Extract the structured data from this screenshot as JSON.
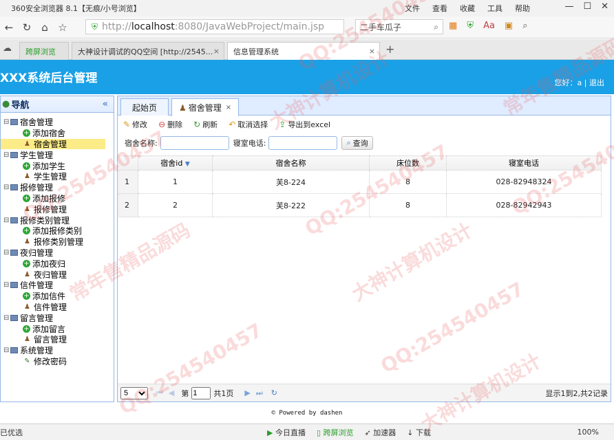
{
  "browser": {
    "window_title": "360安全浏览器 8.1【无痕/小号浏览】",
    "menus": [
      "文件",
      "查看",
      "收藏",
      "工具",
      "帮助"
    ],
    "address_prefix": "http://",
    "address_host": "localhost",
    "address_rest": ":8080/JavaWebProject/main.jsp",
    "search_text": "二手车瓜子",
    "tabs": [
      {
        "label": "跨屏浏览"
      },
      {
        "label": "大神设计调试的QQ空间 [http://2545..."
      },
      {
        "label": "信息管理系统"
      }
    ]
  },
  "app": {
    "title": "XXX系统后台管理",
    "user_text": "您好：a",
    "logout": "退出"
  },
  "sidenav": {
    "title": "导航",
    "groups": [
      {
        "label": "宿舍管理",
        "children": [
          {
            "label": "添加宿舍",
            "icon": "add"
          },
          {
            "label": "宿舍管理",
            "icon": "user",
            "selected": true
          }
        ]
      },
      {
        "label": "学生管理",
        "children": [
          {
            "label": "添加学生",
            "icon": "add"
          },
          {
            "label": "学生管理",
            "icon": "user"
          }
        ]
      },
      {
        "label": "报修管理",
        "children": [
          {
            "label": "添加报修",
            "icon": "add"
          },
          {
            "label": "报修管理",
            "icon": "user"
          }
        ]
      },
      {
        "label": "报修类别管理",
        "children": [
          {
            "label": "添加报修类别",
            "icon": "add"
          },
          {
            "label": "报修类别管理",
            "icon": "user"
          }
        ]
      },
      {
        "label": "夜归管理",
        "children": [
          {
            "label": "添加夜归",
            "icon": "add"
          },
          {
            "label": "夜归管理",
            "icon": "user"
          }
        ]
      },
      {
        "label": "信件管理",
        "children": [
          {
            "label": "添加信件",
            "icon": "add"
          },
          {
            "label": "信件管理",
            "icon": "user"
          }
        ]
      },
      {
        "label": "留言管理",
        "children": [
          {
            "label": "添加留言",
            "icon": "add"
          },
          {
            "label": "留言管理",
            "icon": "user"
          }
        ]
      },
      {
        "label": "系统管理",
        "children": [
          {
            "label": "修改密码",
            "icon": "pen"
          }
        ]
      }
    ]
  },
  "content": {
    "tabs": [
      {
        "label": "起始页"
      },
      {
        "label": "宿舍管理"
      }
    ],
    "toolbar": {
      "edit": "修改",
      "delete": "删除",
      "refresh": "刷新",
      "deselect": "取消选择",
      "export": "导出到excel"
    },
    "filters": {
      "name_label": "宿舍名称:",
      "name_value": "",
      "phone_label": "寝室电话:",
      "phone_value": "",
      "query_button": "查询"
    },
    "table": {
      "columns": [
        "宿舍id",
        "宿舍名称",
        "床位数",
        "寝室电话"
      ],
      "rows": [
        {
          "rownum": "1",
          "id": "1",
          "name": "芙8-224",
          "beds": "8",
          "phone": "028-82948324"
        },
        {
          "rownum": "2",
          "id": "2",
          "name": "芙8-222",
          "beds": "8",
          "phone": "028-82942943"
        }
      ]
    },
    "pager": {
      "page_size": "5",
      "page_prefix": "第",
      "page_value": "1",
      "page_suffix": "共1页",
      "info": "显示1到2,共2记录"
    }
  },
  "footer": "Powered by dashen",
  "statusbar": {
    "left": "已优选",
    "items": [
      "今日直播",
      "跨屏浏览",
      "加速器",
      "下载"
    ],
    "zoom": "100%"
  },
  "watermarks": [
    "QQ:254540457",
    "常年售精品源码",
    "大神计算机设计"
  ]
}
